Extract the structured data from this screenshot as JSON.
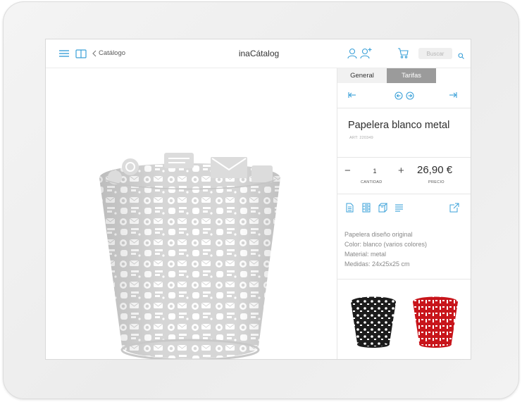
{
  "header": {
    "back_label": "Catálogo",
    "app_title": "inaCátalog",
    "search_placeholder": "Buscar",
    "icons": [
      "menu-icon",
      "book-icon",
      "chevron-left-icon",
      "user-icon",
      "add-user-icon",
      "cart-icon",
      "search-icon"
    ]
  },
  "tabs": [
    {
      "label": "General",
      "active": true
    },
    {
      "label": "Tarifas",
      "active": false
    }
  ],
  "navigation": {
    "icons": [
      "first-icon",
      "prev-icon",
      "next-icon",
      "last-icon"
    ]
  },
  "product": {
    "name": "Papelera blanco metal",
    "ref": "ART: 220349"
  },
  "quantity": {
    "minus": "−",
    "value": "1",
    "plus": "+",
    "label": "CANTIDAD"
  },
  "price": {
    "value": "26,90 €",
    "label": "PRECIO"
  },
  "actions": [
    "document-icon",
    "list-detail-icon",
    "boxes-icon",
    "text-lines-icon",
    "external-link-icon"
  ],
  "description": [
    "Papelera diseño original",
    "Color: blanco (varios colores)",
    "Material: metal",
    "Medidas: 24x25x25 cm"
  ],
  "variants": [
    {
      "color": "black",
      "hex": "#1c1c1c"
    },
    {
      "color": "red",
      "hex": "#c8151b"
    }
  ],
  "colors": {
    "accent": "#3aa0d8",
    "tab_inactive_bg": "#9b9b9b",
    "tab_active_bg": "#f1f1f1",
    "basket_white": "#d8d8d8"
  }
}
